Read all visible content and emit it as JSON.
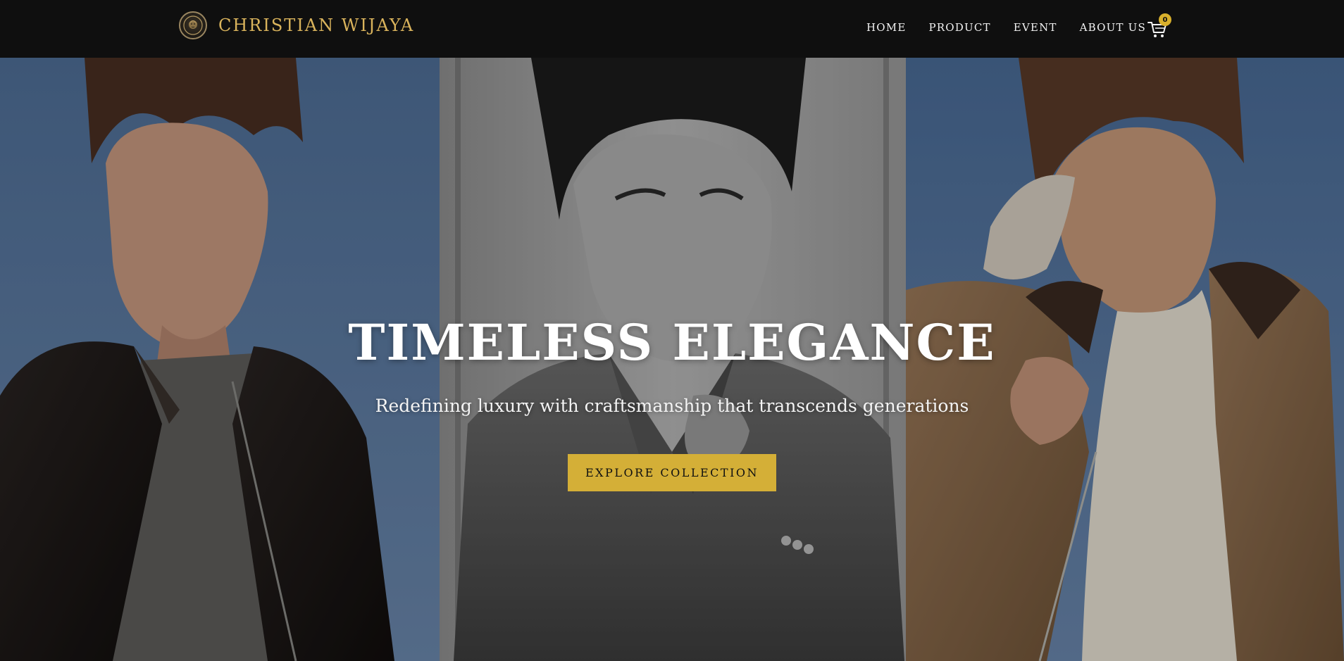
{
  "brand": {
    "name": "CHRISTIAN WIJAYA",
    "logo_icon": "lion-crest-icon",
    "color": "#d9b35c"
  },
  "nav": {
    "items": [
      {
        "label": "HOME"
      },
      {
        "label": "PRODUCT"
      },
      {
        "label": "EVENT"
      },
      {
        "label": "ABOUT US"
      }
    ],
    "cart": {
      "icon": "shopping-cart-icon",
      "count": "0",
      "badge_color": "#d9b02c"
    }
  },
  "hero": {
    "title": "TIMELESS ELEGANCE",
    "subtitle": "Redefining luxury with craftsmanship that transcends generations",
    "cta_label": "EXPLORE COLLECTION",
    "cta_color": "#d4af37",
    "images": [
      {
        "icon": "model-leather-jacket-photo"
      },
      {
        "icon": "model-grey-coat-photo"
      },
      {
        "icon": "model-shearling-jacket-photo"
      }
    ]
  },
  "colors": {
    "header_bg": "#0f0f0f",
    "sky_blue": "#5d7ea8",
    "accent_gold": "#d4af37"
  }
}
